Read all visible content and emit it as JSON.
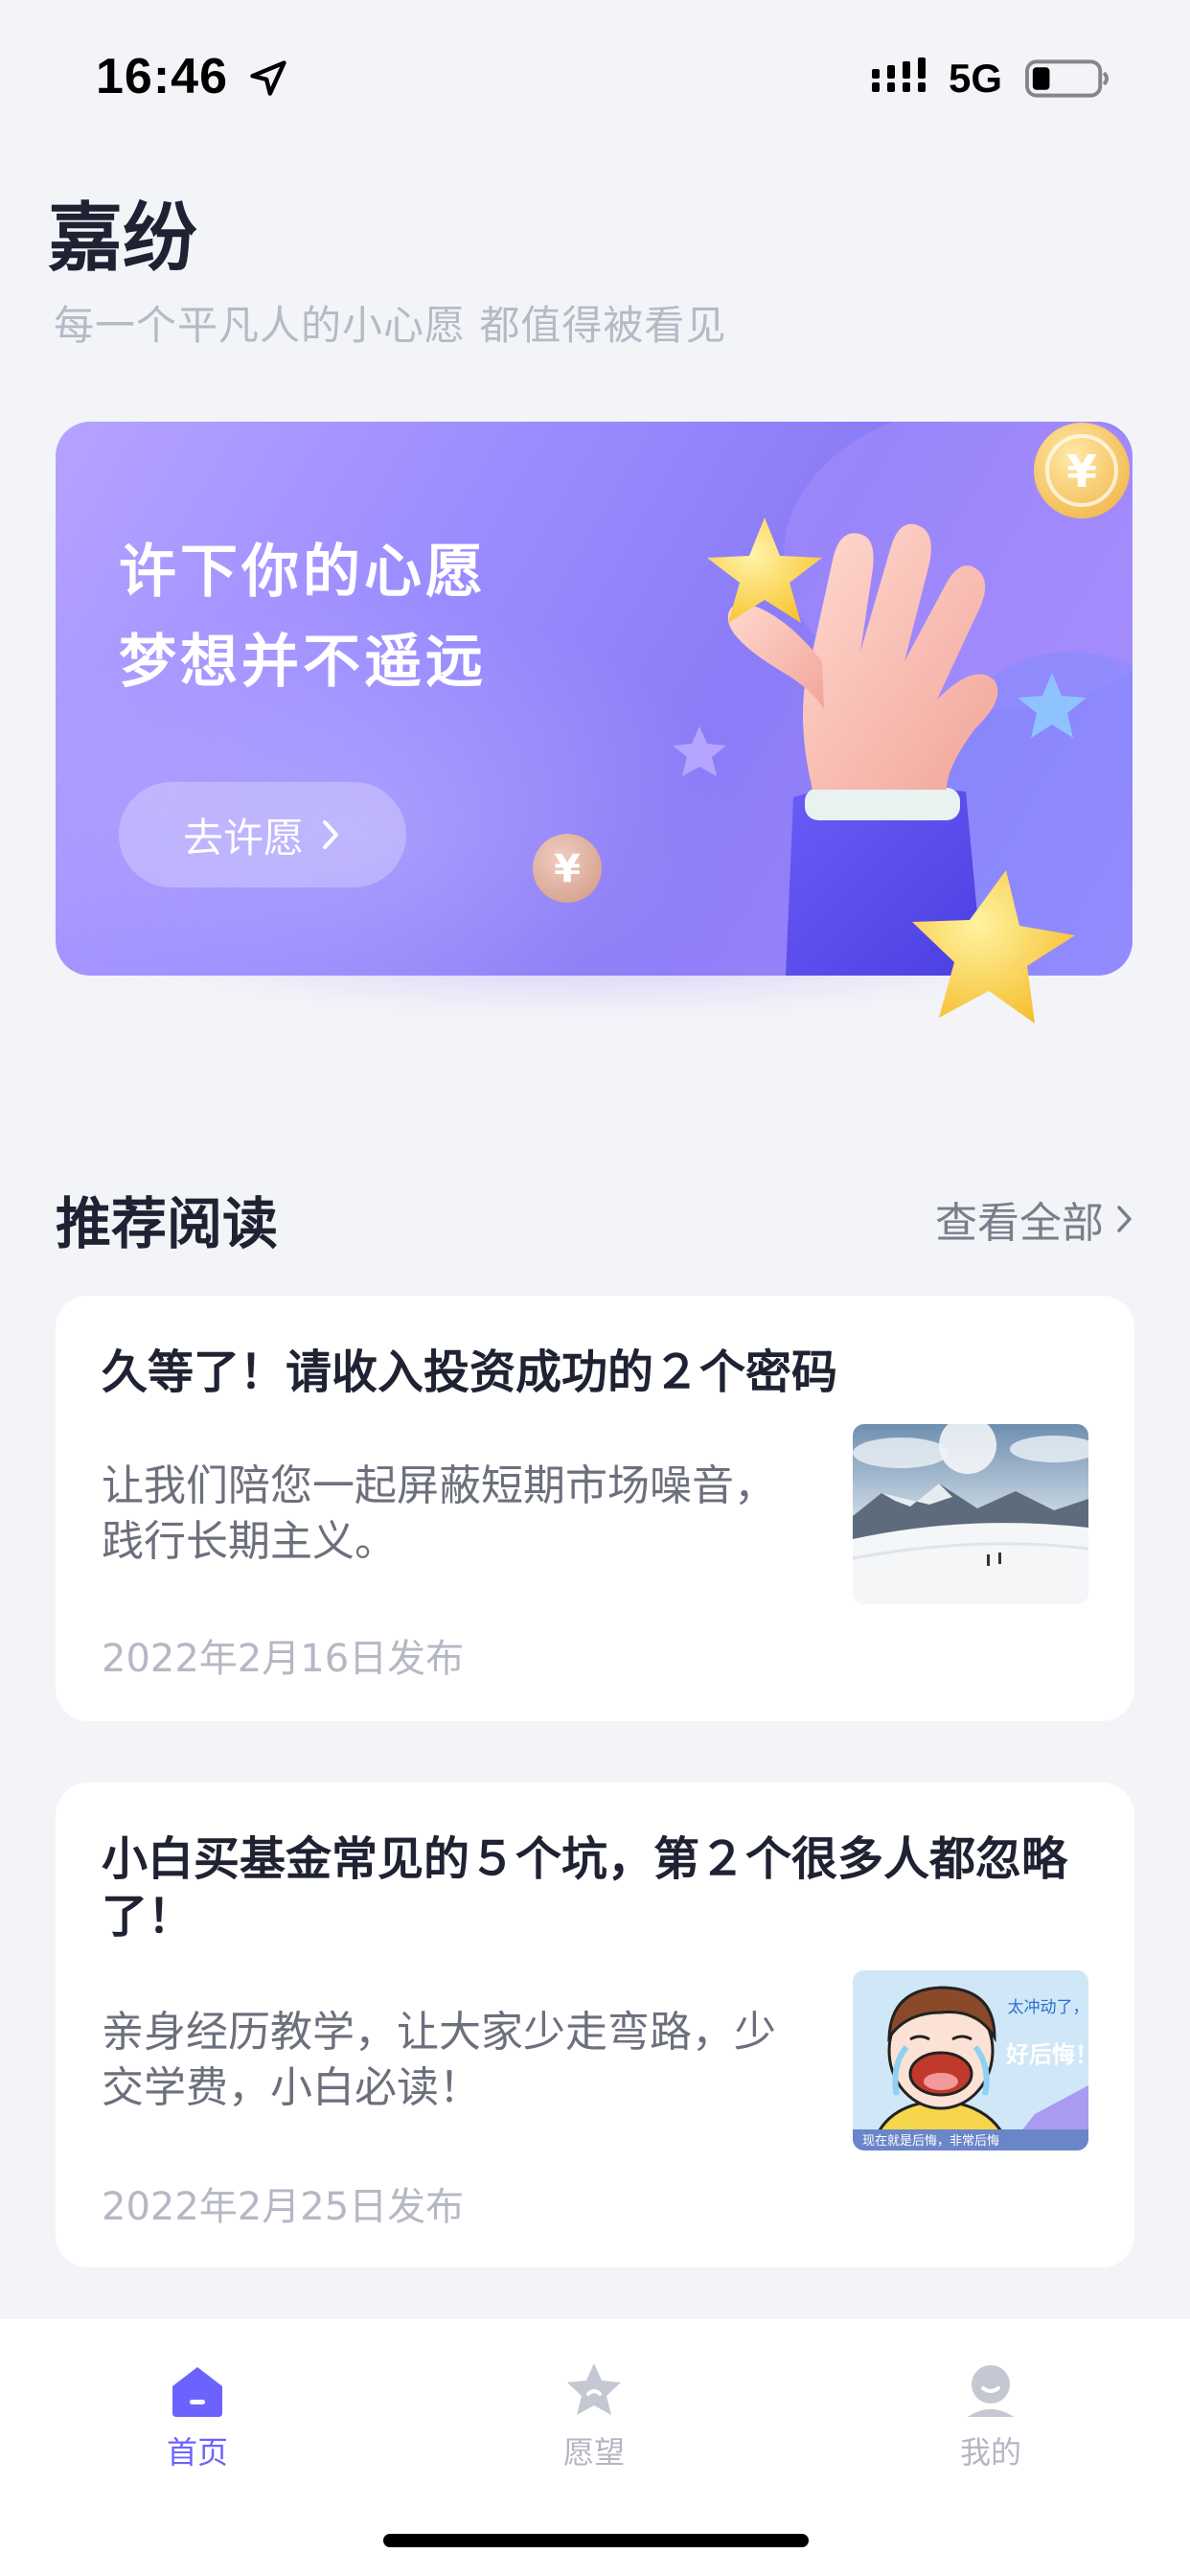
{
  "status_bar": {
    "time": "16:46",
    "network": "5G",
    "icons": [
      "location-arrow-icon",
      "signal-icon",
      "battery-icon"
    ]
  },
  "header": {
    "title": "嘉纷",
    "subtitle": "每一个平凡人的小心愿 都值得被看见"
  },
  "banner": {
    "line1": "许下你的心愿",
    "line2": "梦想并不遥远",
    "button_label": "去许愿",
    "coin_symbol": "¥"
  },
  "reading": {
    "section_title": "推荐阅读",
    "view_all_label": "查看全部",
    "articles": [
      {
        "title": "久等了！请收入投资成功的２个密码",
        "summary": "让我们陪您一起屏蔽短期市场噪音，践行长期主义。",
        "date": "2022年2月16日发布"
      },
      {
        "title": "小白买基金常见的５个坑，第２个很多人都忽略了！",
        "summary": "亲身经历教学，让大家少走弯路，少交学费，小白必读！",
        "date": "2022年2月25日发布",
        "thumb_caption_1": "太冲动了，",
        "thumb_caption_2": "好后悔！",
        "thumb_footer": "现在就是后悔，非常后悔"
      }
    ]
  },
  "tab_bar": {
    "tabs": [
      {
        "label": "首页",
        "icon": "home-icon",
        "active": true
      },
      {
        "label": "愿望",
        "icon": "star-icon",
        "active": false
      },
      {
        "label": "我的",
        "icon": "profile-icon",
        "active": false
      }
    ],
    "active_color": "#6c63ff",
    "inactive_color": "#b4b6c2"
  }
}
